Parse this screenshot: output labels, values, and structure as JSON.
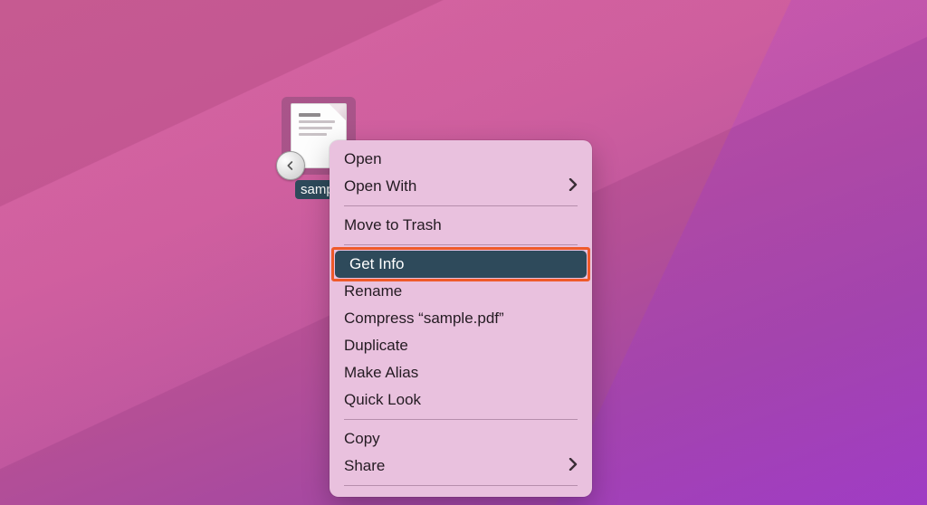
{
  "file": {
    "label": "sampl"
  },
  "menu": {
    "open": "Open",
    "open_with": "Open With",
    "move_to_trash": "Move to Trash",
    "get_info": "Get Info",
    "rename": "Rename",
    "compress": "Compress “sample.pdf”",
    "duplicate": "Duplicate",
    "make_alias": "Make Alias",
    "quick_look": "Quick Look",
    "copy": "Copy",
    "share": "Share"
  }
}
